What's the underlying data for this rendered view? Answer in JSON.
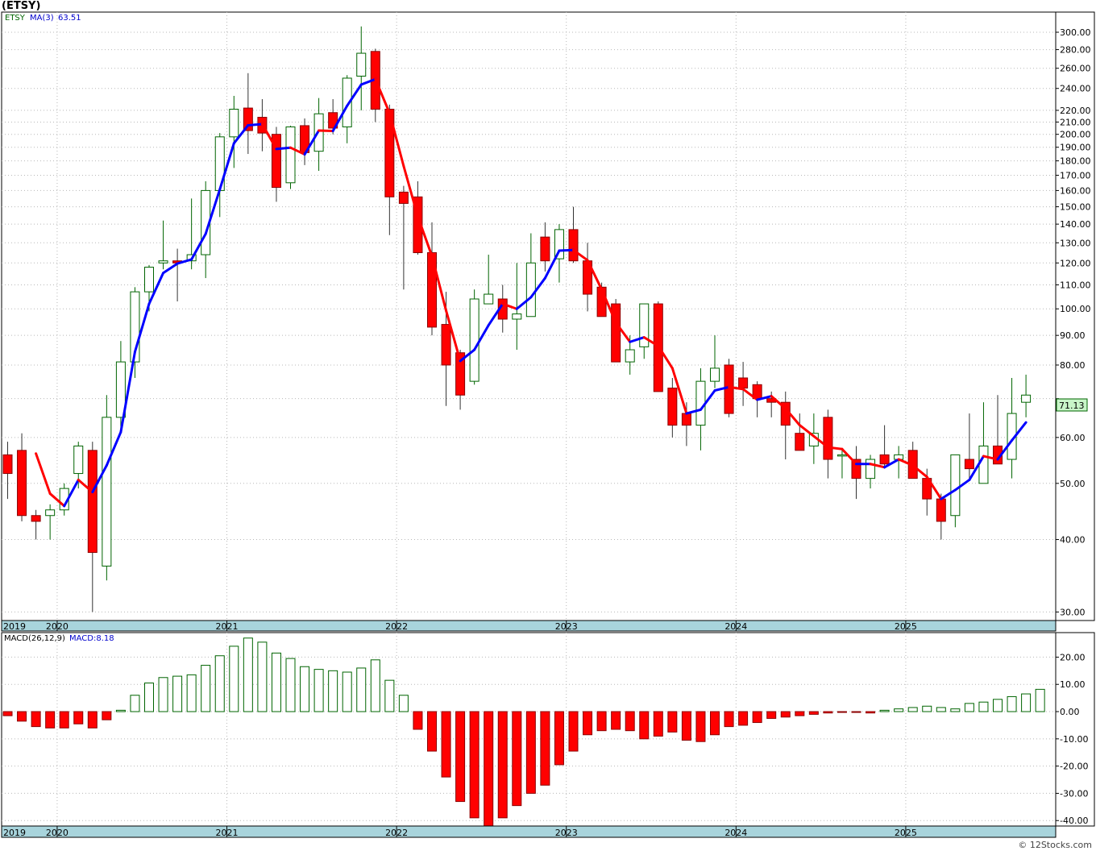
{
  "header": {
    "symbol_title": "(ETSY)"
  },
  "watermark": "© 12Stocks.com",
  "chart_data": [
    {
      "type": "candlestick",
      "symbol": "ETSY",
      "interval": "monthly",
      "yscale": "log",
      "ylim": [
        29,
        325
      ],
      "yticks": [
        30,
        40,
        50,
        60,
        70,
        80,
        90,
        100,
        110,
        120,
        130,
        140,
        150,
        160,
        170,
        180,
        190,
        200,
        210,
        220,
        240,
        260,
        280,
        300
      ],
      "ytick_labels": [
        "30.00",
        "40.00",
        "50.00",
        "60.00",
        "",
        "80.00",
        "90.00",
        "100.00",
        "110.00",
        "120.00",
        "130.00",
        "140.00",
        "150.00",
        "160.00",
        "170.00",
        "180.00",
        "190.00",
        "200.00",
        "210.00",
        "220.00",
        "240.00",
        "260.00",
        "280.00",
        "300.00"
      ],
      "x_year_labels": [
        {
          "label": "2019",
          "index": 0
        },
        {
          "label": "2020",
          "index": 4
        },
        {
          "label": "2021",
          "index": 16
        },
        {
          "label": "2022",
          "index": 28
        },
        {
          "label": "2023",
          "index": 40
        },
        {
          "label": "2024",
          "index": 52
        },
        {
          "label": "2025",
          "index": 64
        }
      ],
      "legend": {
        "series": "ETSY",
        "ma_label": "MA(3)",
        "ma_value": "63.51"
      },
      "last_price_label": "71.13",
      "colors": {
        "up": "#ffffff",
        "up_edge": "#006400",
        "down": "#ff0000",
        "down_edge": "#8b0000",
        "ma_up": "#0000ff",
        "ma_down": "#ff0000",
        "axis_bar": "#a8d4dc",
        "last_label_bg": "#c8f5c8"
      },
      "ohlc": [
        [
          56,
          59,
          47,
          52
        ],
        [
          57,
          61,
          43,
          44
        ],
        [
          44,
          45,
          40,
          43
        ],
        [
          44,
          46,
          40,
          45
        ],
        [
          45,
          50,
          44,
          49
        ],
        [
          52,
          59,
          49,
          58
        ],
        [
          57,
          59,
          30,
          38
        ],
        [
          36,
          71,
          34,
          65
        ],
        [
          65,
          88,
          62,
          81
        ],
        [
          81,
          109,
          76,
          107
        ],
        [
          107,
          119,
          99,
          118
        ],
        [
          120,
          142,
          117,
          121
        ],
        [
          121,
          127,
          103,
          120
        ],
        [
          121,
          155,
          117,
          124
        ],
        [
          124,
          166,
          113,
          160
        ],
        [
          160,
          201,
          144,
          198
        ],
        [
          198,
          233,
          175,
          221
        ],
        [
          222,
          255,
          185,
          203
        ],
        [
          214,
          230,
          187,
          201
        ],
        [
          200,
          206,
          153,
          162
        ],
        [
          165,
          207,
          161,
          206
        ],
        [
          207,
          213,
          177,
          186
        ],
        [
          187,
          231,
          173,
          217
        ],
        [
          218,
          230,
          200,
          205
        ],
        [
          206,
          253,
          193,
          250
        ],
        [
          252,
          307,
          220,
          276
        ],
        [
          278,
          281,
          210,
          221
        ],
        [
          221,
          225,
          134,
          156
        ],
        [
          159,
          163,
          108,
          152
        ],
        [
          156,
          166,
          124,
          125
        ],
        [
          125,
          141,
          90,
          93
        ],
        [
          94,
          107,
          68,
          80
        ],
        [
          84,
          85,
          67,
          71
        ],
        [
          75,
          108,
          74,
          104
        ],
        [
          102,
          124,
          102,
          106
        ],
        [
          104,
          110,
          91,
          96
        ],
        [
          96,
          120,
          85,
          98
        ],
        [
          97,
          135,
          97,
          120
        ],
        [
          133,
          141,
          116,
          121
        ],
        [
          122,
          140,
          111,
          137
        ],
        [
          137,
          150,
          120,
          121
        ],
        [
          121,
          130,
          99,
          106
        ],
        [
          109,
          111,
          100,
          97
        ],
        [
          102,
          104,
          81,
          81
        ],
        [
          81,
          90,
          77,
          85
        ],
        [
          86,
          102,
          82,
          102
        ],
        [
          102,
          103,
          77,
          72
        ],
        [
          73,
          76,
          60,
          63
        ],
        [
          66,
          69,
          58,
          63
        ],
        [
          63,
          79,
          57,
          75
        ],
        [
          75,
          90,
          73,
          79
        ],
        [
          80,
          82,
          65,
          66
        ],
        [
          76,
          81,
          68,
          73
        ],
        [
          74,
          75,
          65,
          70
        ],
        [
          70,
          72,
          65,
          69
        ],
        [
          69,
          72,
          55,
          63
        ],
        [
          61,
          66,
          57,
          57
        ],
        [
          58,
          66,
          54,
          61
        ],
        [
          65,
          67,
          51,
          55
        ],
        [
          56,
          57,
          51,
          56
        ],
        [
          55,
          58,
          47,
          51
        ],
        [
          51,
          56,
          49,
          55
        ],
        [
          56,
          63,
          53,
          54
        ],
        [
          55,
          58,
          51,
          56
        ],
        [
          57,
          59,
          51,
          51
        ],
        [
          51,
          53,
          44,
          47
        ],
        [
          47,
          48,
          40,
          43
        ],
        [
          44,
          56,
          42,
          56
        ],
        [
          55,
          66,
          51,
          53
        ],
        [
          50,
          69,
          50,
          58
        ],
        [
          58,
          71,
          54,
          54
        ],
        [
          55,
          76,
          51,
          66
        ],
        [
          69,
          77,
          65,
          71
        ]
      ],
      "ma3": [
        null,
        null,
        56.3,
        48.0,
        45.7,
        50.7,
        48.3,
        53.7,
        61.3,
        84.3,
        102.0,
        115.3,
        119.7,
        121.7,
        134.7,
        160.7,
        193.0,
        207.3,
        208.3,
        188.7,
        189.7,
        184.7,
        203.0,
        202.7,
        224.0,
        243.7,
        249.0,
        217.7,
        176.3,
        144.3,
        123.3,
        99.3,
        81.3,
        85.0,
        93.7,
        102.0,
        100.0,
        104.7,
        113.0,
        126.0,
        126.3,
        121.3,
        108.0,
        94.7,
        87.7,
        89.3,
        86.3,
        79.0,
        66.0,
        67.0,
        72.3,
        73.3,
        72.7,
        69.7,
        70.7,
        67.3,
        63.0,
        60.3,
        57.7,
        57.3,
        54.0,
        54.0,
        53.3,
        55.0,
        53.7,
        51.3,
        47.0,
        48.7,
        50.7,
        55.7,
        55.0,
        59.3,
        63.7
      ]
    },
    {
      "type": "bar",
      "title": "MACD(26,12,9)",
      "value_label": "MACD:8.18",
      "ylim": [
        -42,
        29
      ],
      "yticks": [
        -40,
        -30,
        -20,
        -10,
        0,
        10,
        20
      ],
      "ytick_labels": [
        "-40.00",
        "-30.00",
        "-20.00",
        "-10.00",
        "0.00",
        "10.00",
        "20.00"
      ],
      "values": [
        -1.5,
        -3.5,
        -5.5,
        -6.0,
        -6.0,
        -4.5,
        -6.0,
        -3.0,
        0.5,
        6.0,
        10.5,
        12.5,
        13.0,
        13.5,
        17.0,
        20.5,
        24.0,
        27.0,
        25.5,
        21.5,
        19.5,
        16.5,
        15.5,
        15.0,
        14.5,
        16.0,
        19.0,
        11.5,
        6.0,
        -6.5,
        -14.5,
        -24.0,
        -33.0,
        -39.0,
        -42.0,
        -39.0,
        -34.5,
        -30.0,
        -27.0,
        -19.5,
        -14.5,
        -8.5,
        -7.0,
        -6.5,
        -7.0,
        -10.0,
        -9.0,
        -7.5,
        -10.5,
        -11.0,
        -8.5,
        -5.5,
        -5.0,
        -4.0,
        -2.5,
        -2.0,
        -1.5,
        -1.0,
        -0.5,
        -0.2,
        -0.3,
        -0.5,
        0.5,
        1.0,
        1.5,
        2.0,
        1.5,
        1.0,
        3.0,
        3.5,
        4.5,
        5.5,
        6.5,
        8.18
      ]
    }
  ]
}
